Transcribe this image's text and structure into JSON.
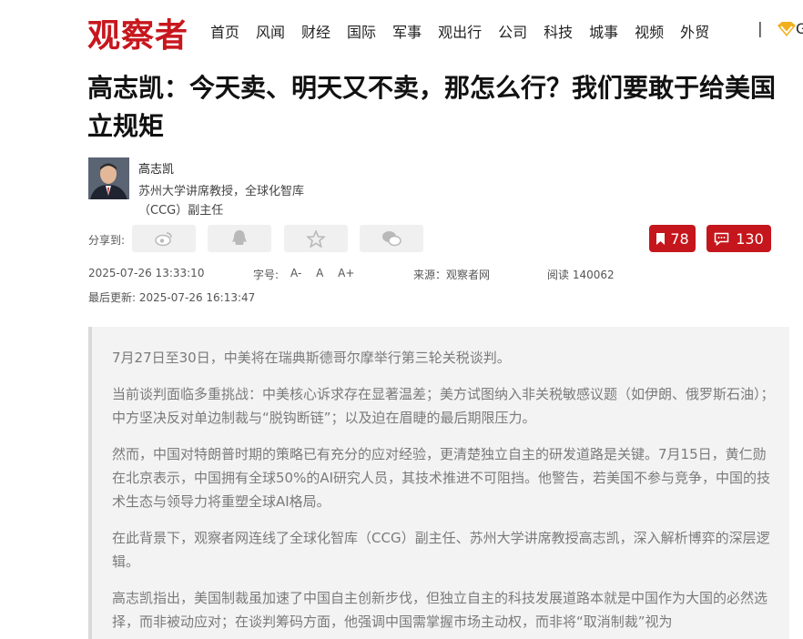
{
  "header": {
    "logo_text": "观察者",
    "nav": [
      "首页",
      "风闻",
      "财经",
      "国际",
      "军事",
      "观出行",
      "公司",
      "科技",
      "城事",
      "视频",
      "外贸"
    ],
    "separator": "|",
    "cut_text": "G"
  },
  "article": {
    "title": "高志凯：今天卖、明天又不卖，那怎么行？我们要敢于给美国立规矩",
    "author": {
      "name": "高志凯",
      "desc": "苏州大学讲席教授，全球化智库（CCG）副主任"
    },
    "share_label": "分享到:",
    "share_icons": [
      "weibo-icon",
      "qq-icon",
      "star-icon",
      "wechat-icon"
    ],
    "bookmark_count": "78",
    "comment_count": "130",
    "date": "2025-07-26 13:33:10",
    "font_label": "字号:",
    "font_sizes": [
      "A-",
      "A",
      "A+"
    ],
    "source": "来源：观察者网",
    "reads": "阅读 140062",
    "updated": "最后更新: 2025-07-26 16:13:47",
    "summary": [
      "7月27日至30日，中美将在瑞典斯德哥尔摩举行第三轮关税谈判。",
      "当前谈判面临多重挑战：中美核心诉求存在显著温差；美方试图纳入非关税敏感议题（如伊朗、俄罗斯石油）；中方坚决反对单边制裁与“脱钩断链”；以及迫在眉睫的最后期限压力。",
      "然而，中国对特朗普时期的策略已有充分的应对经验，更清楚独立自主的研发道路是关键。7月15日，黄仁勋在北京表示，中国拥有全球50%的AI研究人员，其技术推进不可阻挡。他警告，若美国不参与竞争，中国的技术生态与领导力将重塑全球AI格局。",
      "在此背景下，观察者网连线了全球化智库（CCG）副主任、苏州大学讲席教授高志凯，深入解析博弈的深层逻辑。",
      "高志凯指出，美国制裁虽加速了中国自主创新步伐，但独立自主的科技发展道路本就是中国作为大国的必然选择，而非被动应对；在谈判筹码方面，他强调中国需掌握市场主动权，而非将“取消制裁”视为"
    ]
  },
  "colors": {
    "brand": "#c8161d",
    "count_bg": "#c4161c"
  }
}
